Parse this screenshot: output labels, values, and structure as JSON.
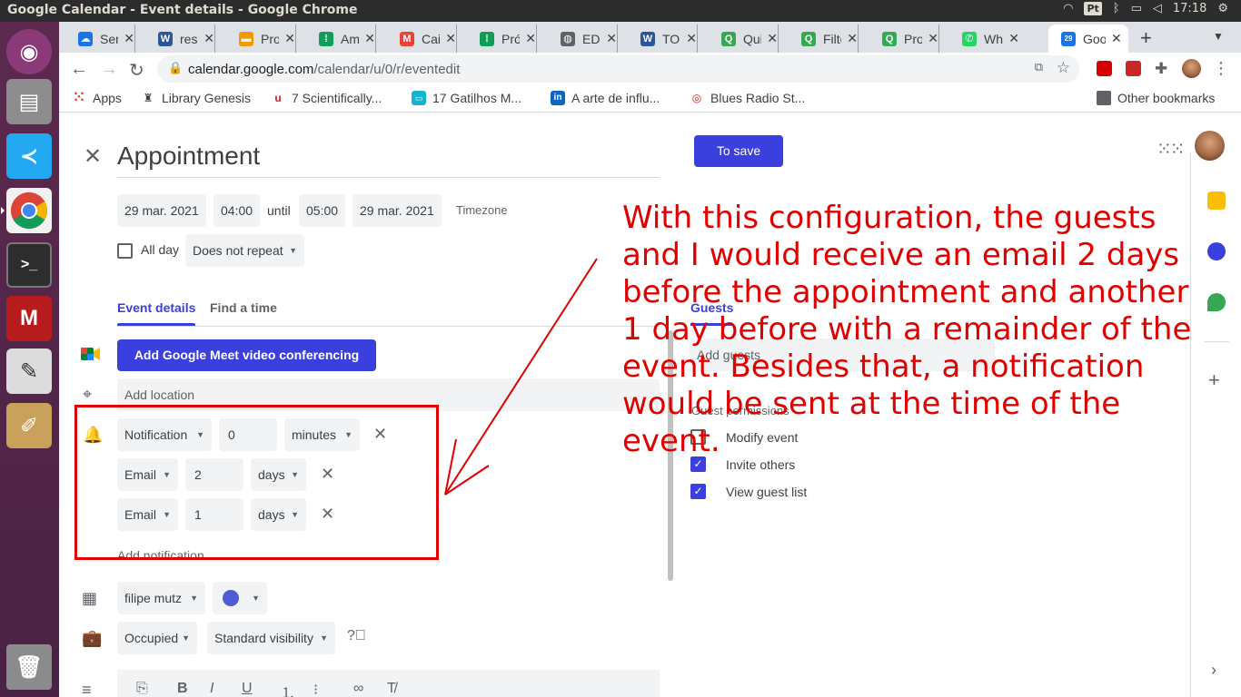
{
  "window": {
    "title": "Google Calendar - Event details - Google Chrome"
  },
  "system_tray": {
    "lang": "Pt",
    "time": "17:18"
  },
  "tabs": [
    {
      "label": "Sem",
      "color": "#1a73e8",
      "glyph": "☁"
    },
    {
      "label": "resu",
      "color": "#2b579a",
      "glyph": "W"
    },
    {
      "label": "Pro",
      "color": "#f29900",
      "glyph": "▬"
    },
    {
      "label": "Aml",
      "color": "#0f9d58",
      "glyph": "⁞"
    },
    {
      "label": "Caix",
      "color": "#ea4335",
      "glyph": "M"
    },
    {
      "label": "Pró",
      "color": "#0f9d58",
      "glyph": "⁞"
    },
    {
      "label": "EDI",
      "color": "#5f6368",
      "glyph": "◍"
    },
    {
      "label": "TOD",
      "color": "#2b579a",
      "glyph": "W"
    },
    {
      "label": "Qui",
      "color": "#34a853",
      "glyph": "Q"
    },
    {
      "label": "Filte",
      "color": "#34a853",
      "glyph": "Q"
    },
    {
      "label": "Proj",
      "color": "#34a853",
      "glyph": "Q"
    },
    {
      "label": "Wha",
      "color": "#25d366",
      "glyph": "✆"
    },
    {
      "label": "Goo",
      "color": "#1a73e8",
      "glyph": "29"
    }
  ],
  "toolbar": {
    "url_host": "calendar.google.com",
    "url_path": "/calendar/u/0/r/eventedit"
  },
  "bookmarks": [
    {
      "label": "Apps",
      "color": "#ea4335",
      "glyph": "⁙"
    },
    {
      "label": "Library Genesis",
      "color": "#3c4043",
      "glyph": "♜"
    },
    {
      "label": "7 Scientifically...",
      "color": "#c5221f",
      "glyph": "u"
    },
    {
      "label": "17 Gatilhos M...",
      "color": "#12b5cb",
      "glyph": "▭"
    },
    {
      "label": "A arte de influ...",
      "color": "#0a66c2",
      "glyph": "in"
    },
    {
      "label": "Blues Radio St...",
      "color": "#c5221f",
      "glyph": "◎"
    }
  ],
  "bookmarks_other": "Other bookmarks",
  "event": {
    "title": "Appointment",
    "save_label": "To save",
    "start_date": "29 mar. 2021",
    "start_time": "04:00",
    "until": "until",
    "end_time": "05:00",
    "end_date": "29 mar. 2021",
    "timezone": "Timezone",
    "all_day": "All day",
    "repeat": "Does not repeat",
    "tab_details": "Event details",
    "tab_find": "Find a time",
    "meet_button": "Add Google Meet video conferencing",
    "location_placeholder": "Add location",
    "notifications": [
      {
        "type": "Notification",
        "value": "0",
        "unit": "minutes"
      },
      {
        "type": "Email",
        "value": "2",
        "unit": "days"
      },
      {
        "type": "Email",
        "value": "1",
        "unit": "days"
      }
    ],
    "add_notification": "Add notification",
    "calendar": "filipe mutz",
    "calendar_color": "#4f5bd5",
    "availability": "Occupied",
    "visibility": "Standard visibility"
  },
  "guests": {
    "tab": "Guests",
    "add_placeholder": "Add guests",
    "permissions_title": "Guest permissions",
    "perm_modify": "Modify event",
    "perm_invite": "Invite others",
    "perm_view": "View guest list"
  },
  "annotation": "With this configuration, the guests and I would receive an email 2 days before the appointment and another 1 day before with a remainder of the event. Besides that, a notification would be sent at the time of the event.",
  "colors": {
    "accent": "#3a3fde",
    "annotation": "#e00000"
  }
}
